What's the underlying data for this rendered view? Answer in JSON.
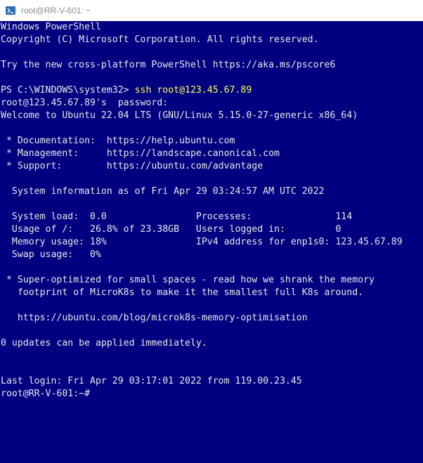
{
  "window": {
    "title": "root@RR-V-601: ~"
  },
  "console": {
    "lines": [
      "Windows PowerShell",
      "Copyright (C) Microsoft Corporation. All rights reserved.",
      "",
      "Try the new cross-platform PowerShell https://aka.ms/pscore6",
      "",
      "",
      "root@123.45.67.89's  password:",
      "Welcome to Ubuntu 22.04 LTS (GNU/Linux 5.15.0-27-generic x86_64)",
      "",
      " * Documentation:  https://help.ubuntu.com",
      " * Management:     https://landscape.canonical.com",
      " * Support:        https://ubuntu.com/advantage",
      "",
      "  System information as of Fri Apr 29 03:24:57 AM UTC 2022",
      "",
      "  System load:  0.0                Processes:               114",
      "  Usage of /:   26.8% of 23.38GB   Users logged in:         0",
      "  Memory usage: 18%                IPv4 address for enp1s0: 123.45.67.89",
      "  Swap usage:   0%",
      "",
      " * Super-optimized for small spaces - read how we shrank the memory",
      "   footprint of MicroK8s to make it the smallest full K8s around.",
      "",
      "   https://ubuntu.com/blog/microk8s-memory-optimisation",
      "",
      "0 updates can be applied immediately.",
      "",
      "",
      "Last login: Fri Apr 29 03:17:01 2022 from 119.00.23.45",
      ""
    ],
    "ps_prompt": "PS C:\\WINDOWS\\system32> ",
    "ps_command": "ssh root@123.45.67.89",
    "shell_prompt": "root@RR-V-601:~#"
  },
  "colors": {
    "background": "#000080",
    "text": "#e8e8e8",
    "command_highlight": "#ffff55",
    "title_text": "#8a8a8a"
  },
  "icons": {
    "app_icon": "powershell-icon"
  }
}
